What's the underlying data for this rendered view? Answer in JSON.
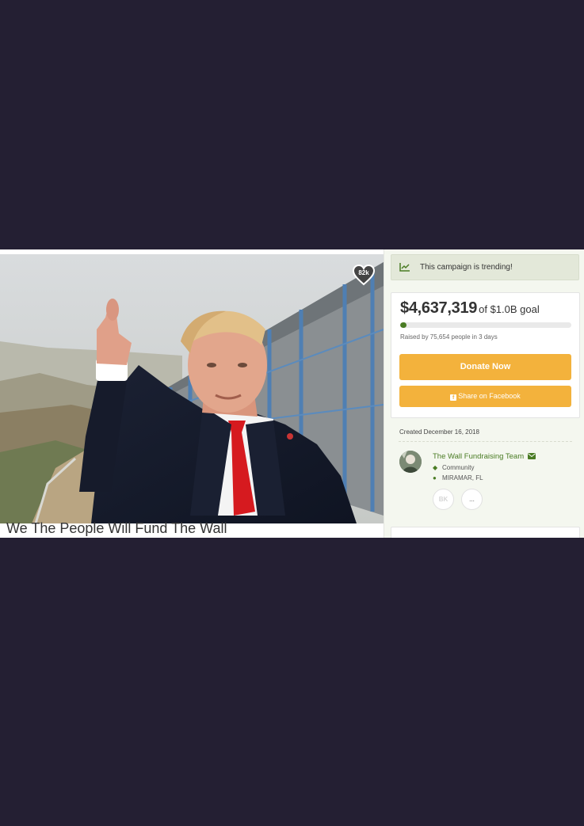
{
  "hero": {
    "favorite_count": "82k"
  },
  "campaign": {
    "title": "We The People Will Fund The Wall"
  },
  "sidebar": {
    "trending_text": "This campaign is trending!",
    "amount_raised": "$4,637,319",
    "goal_text": "of $1.0B goal",
    "progress_fraction": 0.005,
    "raised_text": "Raised by 75,654 people in 3 days",
    "donate_label": "Donate Now",
    "share_label": "Share on Facebook",
    "created_text": "Created December 16, 2018",
    "organizer": {
      "name": "The Wall Fundraising Team",
      "category": "Community",
      "location": "MIRAMAR, FL"
    },
    "action_share_label": "BK",
    "action_more_label": "..."
  },
  "colors": {
    "page_background": "#241f33",
    "accent_orange": "#f3b23c",
    "brand_green": "#4a7c24",
    "trend_banner": "#e3e8d9"
  },
  "icons": {
    "trend": "trend-line-icon",
    "favorite": "heart-icon",
    "facebook": "facebook-icon",
    "email": "envelope-icon",
    "category": "tag-icon",
    "location": "map-pin-icon"
  }
}
